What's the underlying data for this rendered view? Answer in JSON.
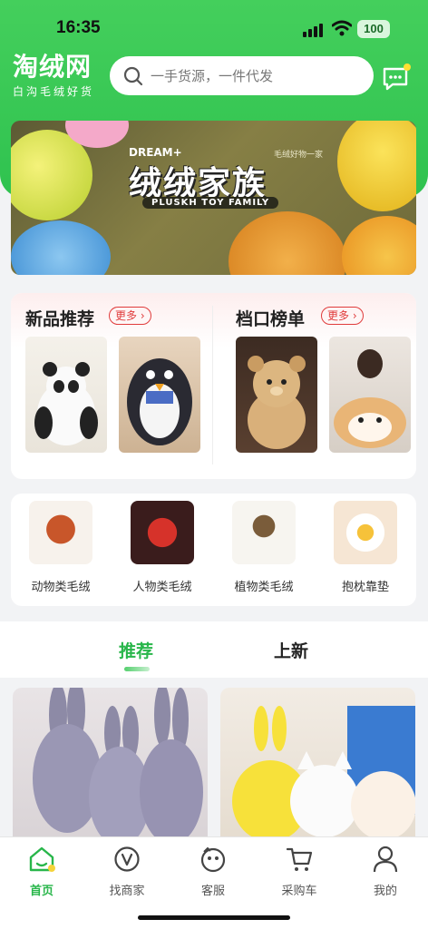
{
  "status_bar": {
    "time": "16:35",
    "battery": "100"
  },
  "header": {
    "logo": "淘绒网",
    "slogan": "白沟毛绒好货",
    "search_placeholder": "一手货源，一件代发"
  },
  "banner": {
    "top": "DREAM+",
    "title": "绒绒家族",
    "subtitle": "PLUSKH TOY FAMILY",
    "tag": "毛绒好物一家"
  },
  "sections": {
    "new": {
      "title": "新品推荐",
      "more": "更多"
    },
    "rank": {
      "title": "档口榜单",
      "more": "更多"
    }
  },
  "categories": [
    {
      "label": "动物类毛绒",
      "icon": "red-panda"
    },
    {
      "label": "人物类毛绒",
      "icon": "santa"
    },
    {
      "label": "植物类毛绒",
      "icon": "potted-plant"
    },
    {
      "label": "抱枕靠垫",
      "icon": "flower-pillow"
    }
  ],
  "tabs": [
    {
      "label": "推荐",
      "active": true
    },
    {
      "label": "上新",
      "active": false
    }
  ],
  "nav": [
    {
      "label": "首页",
      "icon": "home-icon",
      "active": true
    },
    {
      "label": "找商家",
      "icon": "merchant-icon",
      "active": false
    },
    {
      "label": "客服",
      "icon": "service-icon",
      "active": false
    },
    {
      "label": "采购车",
      "icon": "cart-icon",
      "active": false
    },
    {
      "label": "我的",
      "icon": "user-icon",
      "active": false
    }
  ],
  "colors": {
    "brand_green": "#2fc24f",
    "accent_red": "#e03c3c"
  }
}
